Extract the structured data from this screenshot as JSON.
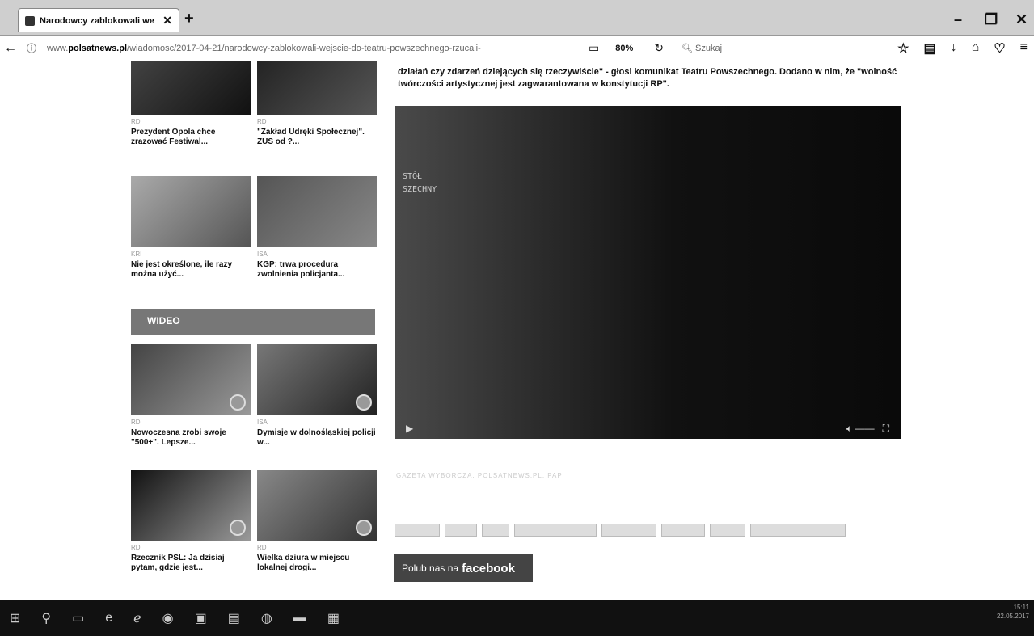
{
  "browser": {
    "tab_title": "Narodowcy zablokowali we",
    "new_tab": "+",
    "url_prefix": "www.",
    "url_domain": "polsatnews.pl",
    "url_path": "/wiadomosc/2017-04-21/narodowcy-zablokowali-wejscie-do-teatru-powszechnego-rzucali-",
    "zoom": "80%",
    "search_placeholder": "Szukaj"
  },
  "sidebar": {
    "cards": [
      {
        "source": "RD",
        "title": "Prezydent Opola chce zrazować Festiwal..."
      },
      {
        "source": "RD",
        "title": "\"Zakład Udręki Społecznej\". ZUS od ?..."
      },
      {
        "source": "KRI",
        "title": "Nie jest określone, ile razy można użyć..."
      },
      {
        "source": "ISA",
        "title": "KGP: trwa procedura zwolnienia policjanta..."
      }
    ],
    "video_header": "WIDEO",
    "video_cards": [
      {
        "source": "RD",
        "title": "Nowoczesna zrobi swoje \"500+\". Lepsze..."
      },
      {
        "source": "ISA",
        "title": "Dymisje w dolnośląskiej policji w..."
      },
      {
        "source": "RD",
        "title": "Rzecznik PSL: Ja dzisiaj pytam, gdzie jest..."
      },
      {
        "source": "RD",
        "title": "Wielka dziura w miejscu lokalnej drogi..."
      }
    ]
  },
  "article": {
    "text": "działań czy zdarzeń dziejących się rzeczywiście\" - głosi komunikat Teatru Powszechnego. Dodano w nim, że \"wolność twórczości artystycznej jest zagwarantowana w konstytucji RP\".",
    "video_sign": "STÓŁ\nSZECHNY",
    "credit": "GAZETA WYBORCZA, POLSATNEWS.PL, PAP",
    "tags": [
      "",
      "",
      "",
      "",
      "",
      "",
      "",
      ""
    ],
    "facebook_prefix": "Polub nas na",
    "facebook_brand": "facebook"
  },
  "system": {
    "time": "15:11",
    "date": "22.05.2017"
  }
}
